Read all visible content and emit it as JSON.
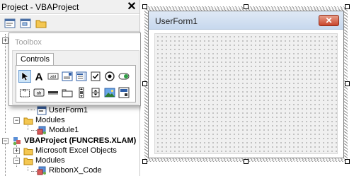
{
  "explorer": {
    "title": "Project - VBAProject",
    "close_glyph": "✕",
    "toolbar": [
      {
        "icon": "view-code-icon"
      },
      {
        "icon": "view-object-icon"
      },
      {
        "icon": "toggle-folders-icon"
      }
    ],
    "tree": {
      "userform1": "UserForm1",
      "modules_1": "Modules",
      "module1": "Module1",
      "vbaproject_funcres": "VBAProject (FUNCRES.XLAM)",
      "excel_objects": "Microsoft Excel Objects",
      "modules_2": "Modules",
      "ribbonx_code": "RibbonX_Code",
      "expander_plus": "+",
      "expander_minus": "−"
    }
  },
  "toolbox": {
    "title": "Toolbox",
    "tab_label": "Controls",
    "tools_row1": [
      "select-objects-icon",
      "label-icon",
      "textbox-icon",
      "combobox-icon",
      "listbox-icon",
      "checkbox-icon",
      "optionbutton-icon",
      "togglebutton-icon"
    ],
    "tools_row2": [
      "frame-icon",
      "commandbutton-icon",
      "tabstrip-icon",
      "multipage-icon",
      "scrollbar-icon",
      "spinbutton-icon",
      "image-icon",
      "refedit-icon"
    ],
    "label_glyph": "A"
  },
  "designer": {
    "form_title": "UserForm1",
    "close_glyph": "✕"
  },
  "colors": {
    "selection_highlight": "#cce4f7",
    "form_close_red": "#c9442a",
    "form_titlebar": "#c7d8ee",
    "grid_background": "#f0f0f0"
  }
}
